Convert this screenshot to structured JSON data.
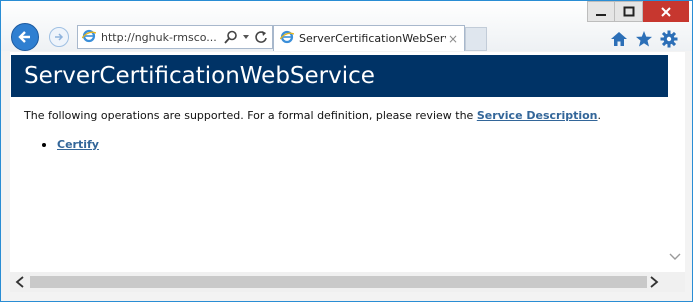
{
  "browser": {
    "address_url": "http://nghuk-rmsco...",
    "tab_title": "ServerCertificationWebServ...",
    "tab_close": "×"
  },
  "page": {
    "heading": "ServerCertificationWebService",
    "intro_text": "The following operations are supported. For a formal definition, please review the ",
    "service_link": "Service Description",
    "intro_end": ".",
    "operations": [
      "Certify"
    ]
  },
  "icons": {
    "minimize": "minimize-icon",
    "maximize": "maximize-icon",
    "close": "close-icon",
    "back": "back-arrow-icon",
    "forward": "forward-arrow-icon",
    "search": "search-icon",
    "refresh": "refresh-icon",
    "home": "home-icon",
    "favorites": "star-icon",
    "settings": "gear-icon"
  },
  "colors": {
    "heading_bg": "#003366",
    "link": "#336699",
    "close_button": "#c7372f",
    "back_button": "#2f7fd1"
  }
}
